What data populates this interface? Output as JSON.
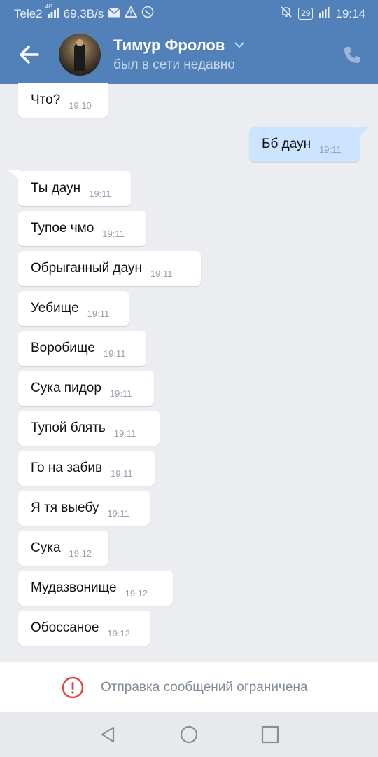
{
  "status_bar": {
    "carrier": "Tele2",
    "network": "4G",
    "speed": "69,3B/s",
    "battery": "29",
    "time": "19:14"
  },
  "header": {
    "back_icon": "arrow-left-icon",
    "name": "Тимур Фролов",
    "status": "был в сети недавно",
    "call_icon": "phone-icon"
  },
  "messages": [
    {
      "dir": "in",
      "text": "Что?",
      "time": "19:10"
    },
    {
      "dir": "out",
      "text": "Бб даун",
      "time": "19:11"
    },
    {
      "dir": "in",
      "text": "Ты даун",
      "time": "19:11"
    },
    {
      "dir": "in",
      "text": "Тупое чмо",
      "time": "19:11"
    },
    {
      "dir": "in",
      "text": "Обрыганный даун",
      "time": "19:11"
    },
    {
      "dir": "in",
      "text": "Уебище",
      "time": "19:11"
    },
    {
      "dir": "in",
      "text": "Воробище",
      "time": "19:11"
    },
    {
      "dir": "in",
      "text": "Сука пидор",
      "time": "19:11"
    },
    {
      "dir": "in",
      "text": "Тупой блять",
      "time": "19:11"
    },
    {
      "dir": "in",
      "text": "Го на забив",
      "time": "19:11"
    },
    {
      "dir": "in",
      "text": "Я тя выебу",
      "time": "19:11"
    },
    {
      "dir": "in",
      "text": "Сука",
      "time": "19:12"
    },
    {
      "dir": "in",
      "text": "Мудазвонище",
      "time": "19:12"
    },
    {
      "dir": "in",
      "text": "Обоссаное",
      "time": "19:12"
    }
  ],
  "restricted": {
    "icon": "warning-circle-icon",
    "text": "Отправка сообщений ограничена"
  },
  "colors": {
    "header": "#5181b8",
    "outgoing_bubble": "#cce4ff",
    "incoming_bubble": "#ffffff",
    "background": "#ebedf0",
    "warning": "#e64646"
  }
}
